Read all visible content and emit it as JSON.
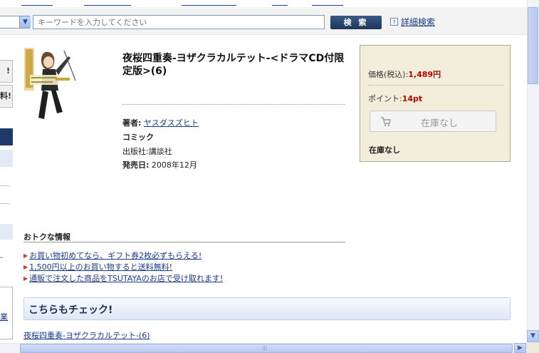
{
  "search": {
    "placeholder": "キーワードを入力してください",
    "button_label": "検 索",
    "advanced_label": "詳細検索"
  },
  "sidebar": {
    "button1_text": "!",
    "button2_text": "料!",
    "box_text": "業"
  },
  "product": {
    "title": "夜桜四重奏-ヨザクラカルテット-<ドラマCD付限定版>(6)",
    "author_label": "著者:",
    "author_name": "ヤスダスズヒト",
    "category": "コミック",
    "publisher_label": "出版社:",
    "publisher_name": "講談社",
    "release_label": "発売日:",
    "release_date": "2008年12月"
  },
  "buybox": {
    "price_label": "価格(税込):",
    "price_value": "1,489円",
    "point_label": "ポイント:",
    "point_value": "14pt",
    "stock_button_label": "在庫なし",
    "stock_status": "在庫なし"
  },
  "deals": {
    "title": "おトクな情報",
    "items": [
      "お買い物初めてなら、ギフト券2枚必ずもらえる!",
      "1,500円以上のお買い物すると送料無料!",
      "通販で注文した商品をTSUTAYAのお店で受け取れます!"
    ]
  },
  "check": {
    "title": "こちらもチェック!",
    "link": "夜桜四重奏-ヨザクラカルテット-(6)"
  },
  "colors": {
    "accent_navy": "#1d3a6b",
    "price_red": "#bb0000",
    "link_blue": "#1a3a8a",
    "buybox_bg": "#f3eedb"
  }
}
